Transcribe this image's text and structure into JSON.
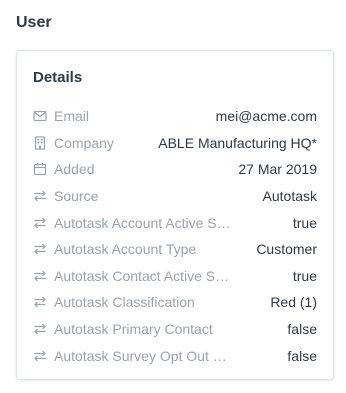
{
  "section": {
    "title": "User"
  },
  "details": {
    "title": "Details",
    "rows": [
      {
        "icon": "envelope-icon",
        "label": "Email",
        "value": "mei@acme.com"
      },
      {
        "icon": "building-icon",
        "label": "Company",
        "value": "ABLE Manufacturing HQ*"
      },
      {
        "icon": "calendar-icon",
        "label": "Added",
        "value": "27 Mar 2019"
      },
      {
        "icon": "sync-arrows-icon",
        "label": "Source",
        "value": "Autotask"
      },
      {
        "icon": "sync-arrows-icon",
        "label": "Autotask Account Active Status",
        "value": "true"
      },
      {
        "icon": "sync-arrows-icon",
        "label": "Autotask Account Type",
        "value": "Customer"
      },
      {
        "icon": "sync-arrows-icon",
        "label": "Autotask Contact Active Status",
        "value": "true"
      },
      {
        "icon": "sync-arrows-icon",
        "label": "Autotask Classification",
        "value": "Red (1)"
      },
      {
        "icon": "sync-arrows-icon",
        "label": "Autotask Primary Contact",
        "value": "false"
      },
      {
        "icon": "sync-arrows-icon",
        "label": "Autotask Survey Opt Out Status",
        "value": "false"
      }
    ]
  },
  "colors": {
    "label": "#9aa3ac",
    "value": "#2f3a45",
    "border": "#dde2e8"
  }
}
